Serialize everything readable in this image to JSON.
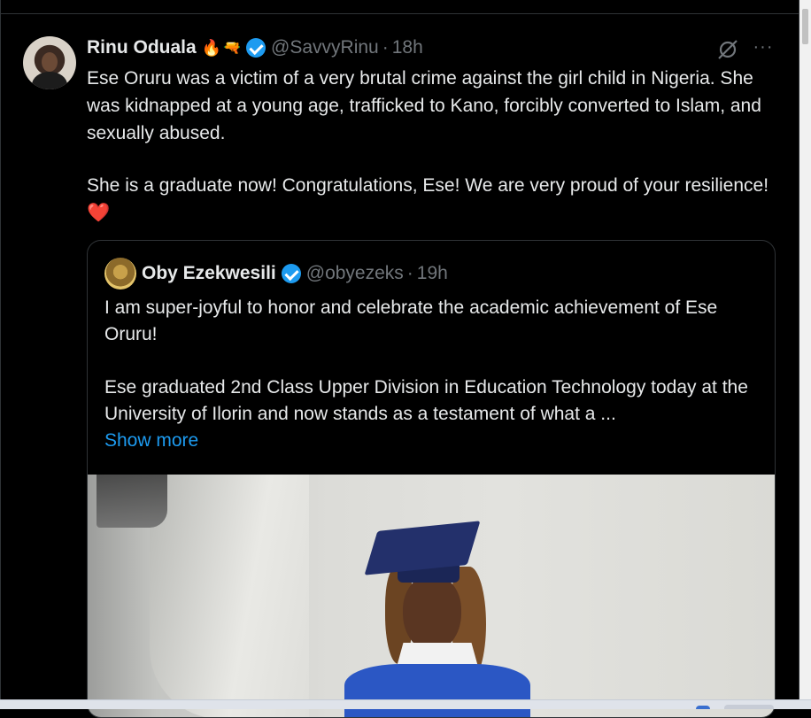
{
  "tweet": {
    "author_name": "Rinu Oduala",
    "author_emoji": "🔥",
    "author_emoji2": "🔫",
    "handle": "@SavvyRinu",
    "separator": "·",
    "time": "18h",
    "paragraph1": "Ese Oruru was a victim of a very brutal crime against the girl child in Nigeria. She was kidnapped at a young age, trafficked to Kano, forcibly converted to Islam, and sexually abused.",
    "paragraph2": "She is a graduate now! Congratulations, Ese! We are very proud of your resilience!",
    "heart": "❤️",
    "more_label": "···"
  },
  "quote": {
    "author_name": "Oby Ezekwesili",
    "handle": "@obyezeks",
    "separator": "·",
    "time": "19h",
    "paragraph1": "I am super-joyful to honor and celebrate the academic achievement of Ese Oruru!",
    "paragraph2": "Ese graduated 2nd Class Upper Division in Education Technology today at the University of Ilorin and now stands as a testament of what a ...",
    "show_more": "Show more"
  },
  "colors": {
    "background": "#000000",
    "text": "#e7e9ea",
    "secondary": "#71767b",
    "accent": "#1d9bf0",
    "border": "#2f3336"
  }
}
